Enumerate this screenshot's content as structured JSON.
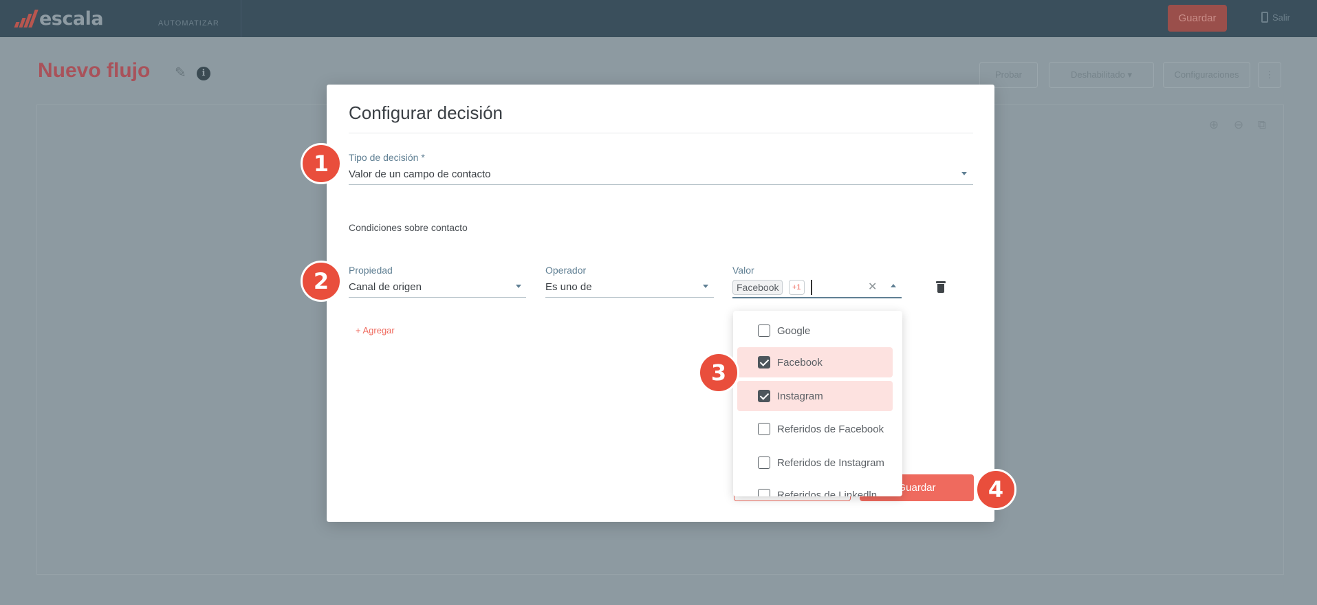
{
  "topbar": {
    "logo_text": "escala",
    "nav_item": "AUTOMATIZAR",
    "save_label": "Guardar",
    "exit_label": "Salir"
  },
  "page": {
    "title": "Nuevo flujo",
    "buttons": {
      "test": "Probar",
      "status": "Deshabilitado",
      "settings": "Configuraciones",
      "more": "⋮"
    }
  },
  "modal": {
    "title": "Configurar decisión",
    "decision_type": {
      "label": "Tipo de decisión *",
      "value": "Valor de un campo de contacto"
    },
    "conditions_label": "Condiciones sobre contacto",
    "property": {
      "label": "Propiedad",
      "value": "Canal de origen"
    },
    "operator": {
      "label": "Operador",
      "value": "Es uno de"
    },
    "value": {
      "label": "Valor",
      "chip": "Facebook",
      "more_count": "+1"
    },
    "add_link": "+ Agregar",
    "save_label": "Guardar",
    "options": [
      {
        "label": "Google",
        "checked": false
      },
      {
        "label": "Facebook",
        "checked": true
      },
      {
        "label": "Instagram",
        "checked": true
      },
      {
        "label": "Referidos de Facebook",
        "checked": false
      },
      {
        "label": "Referidos de Instagram",
        "checked": false
      },
      {
        "label": "Referidos de Linkedln",
        "checked": false
      }
    ]
  },
  "markers": [
    "1",
    "2",
    "3",
    "4"
  ],
  "colors": {
    "accent": "#ef6a5e",
    "marker": "#e94e3c",
    "topbar": "#3a4f5c",
    "overlay": "#8d9aa1"
  }
}
